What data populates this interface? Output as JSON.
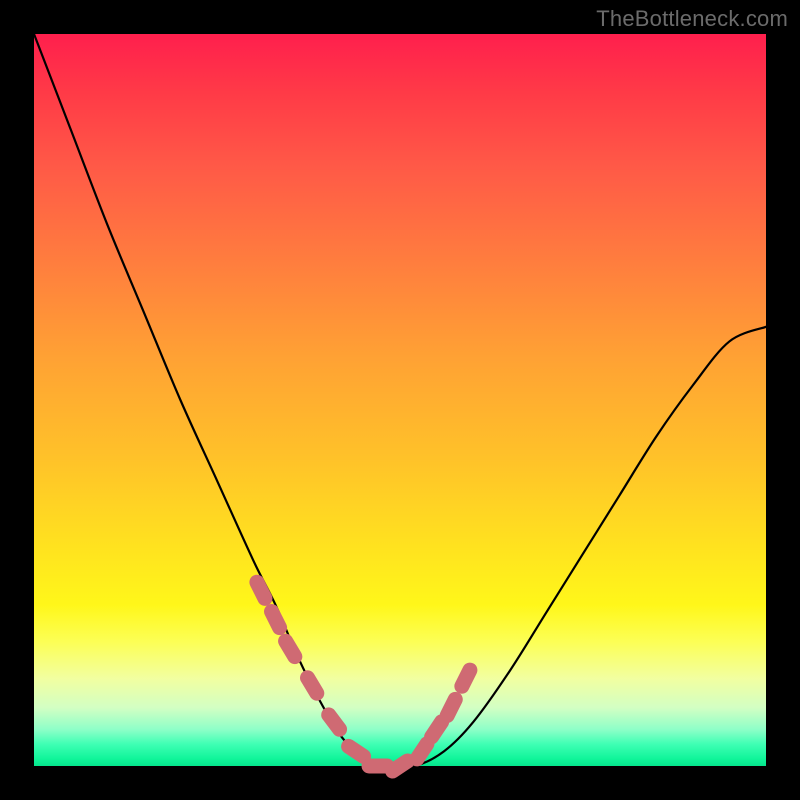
{
  "watermark": "TheBottleneck.com",
  "colors": {
    "frame": "#000000",
    "curve": "#000000",
    "marker": "#cf6a73",
    "gradient_top": "#ff1f4d",
    "gradient_mid": "#ffe21f",
    "gradient_bottom": "#05e58c"
  },
  "chart_data": {
    "type": "line",
    "title": "",
    "xlabel": "",
    "ylabel": "",
    "xlim": [
      0,
      100
    ],
    "ylim": [
      0,
      100
    ],
    "series": [
      {
        "name": "bottleneck-curve",
        "x": [
          0,
          5,
          10,
          15,
          20,
          25,
          30,
          33,
          36,
          39,
          42,
          45,
          48,
          52,
          56,
          60,
          65,
          70,
          75,
          80,
          85,
          90,
          95,
          100
        ],
        "values": [
          100,
          87,
          74,
          62,
          50,
          39,
          28,
          22,
          15,
          9,
          4,
          1,
          0,
          0,
          2,
          6,
          13,
          21,
          29,
          37,
          45,
          52,
          58,
          60
        ]
      }
    ],
    "markers": {
      "name": "highlighted-points",
      "x": [
        31,
        33,
        35,
        38,
        41,
        44,
        47,
        50,
        53,
        55,
        57,
        59
      ],
      "values": [
        24,
        20,
        16,
        11,
        6,
        2,
        0,
        0,
        2,
        5,
        8,
        12
      ]
    }
  }
}
